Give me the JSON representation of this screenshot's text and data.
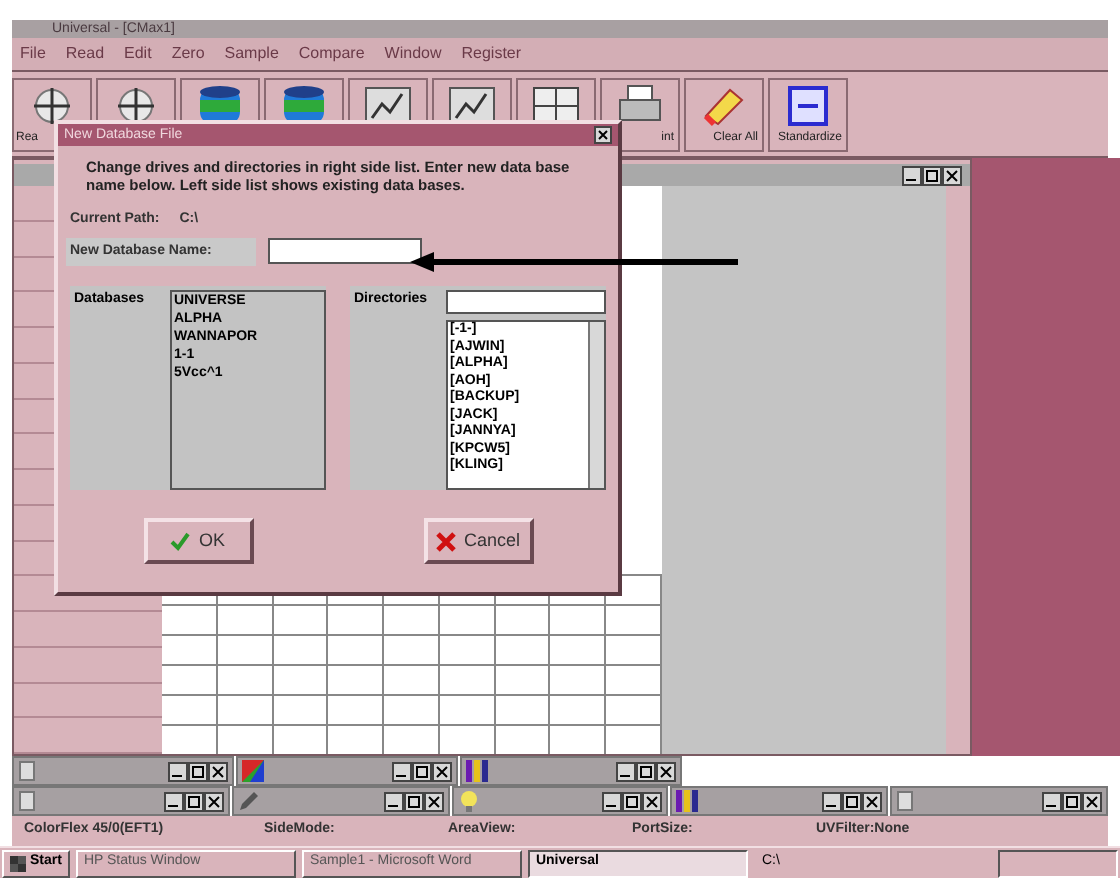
{
  "window": {
    "title": "Universal - [CMax1]"
  },
  "menu": [
    "File",
    "Read",
    "Edit",
    "Zero",
    "Sample",
    "Compare",
    "Window",
    "Register"
  ],
  "toolbar": [
    {
      "kind": "target",
      "label": "Rea"
    },
    {
      "kind": "target"
    },
    {
      "kind": "cylinder"
    },
    {
      "kind": "cylinder"
    },
    {
      "kind": "chart"
    },
    {
      "kind": "chart"
    },
    {
      "kind": "grid"
    },
    {
      "kind": "printer",
      "label": "int"
    },
    {
      "kind": "eraser",
      "label": "Clear All"
    },
    {
      "kind": "standard",
      "label": "Standardize"
    }
  ],
  "dialog": {
    "title": "New Database File",
    "instructions": "Change drives and directories in right side list. Enter new data base name below. Left side list shows existing data bases.",
    "path_label": "Current Path:",
    "path": "C:\\",
    "name_label": "New Database Name:",
    "databases_label": "Databases",
    "databases": [
      "UNIVERSE",
      "ALPHA",
      "WANNAPOR",
      "1-1",
      "5Vcc^1"
    ],
    "directories_label": "Directories",
    "directories": [
      "[-1-]",
      "[AJWIN]",
      "[ALPHA]",
      "[AOH]",
      "[BACKUP]",
      "[JACK]",
      "[JANNYA]",
      "[KPCW5]",
      "[KLING]"
    ],
    "buttons": [
      {
        "kind": "ok",
        "label": "OK"
      },
      {
        "kind": "cancel",
        "label": "Cancel"
      }
    ]
  },
  "minimized": [
    [
      {
        "kind": "doc"
      },
      {
        "kind": "color"
      },
      {
        "kind": "bars"
      }
    ],
    [
      {
        "kind": "doc"
      },
      {
        "kind": "pen"
      },
      {
        "kind": "lamp"
      },
      {
        "kind": "bars"
      },
      {
        "kind": "doc"
      }
    ]
  ],
  "status_bar": [
    "ColorFlex 45/0(EFT1)",
    "SideMode:",
    "AreaView:",
    "PortSize:",
    "UVFilter:None"
  ],
  "taskbar": {
    "start": "Start",
    "tasks": [
      {
        "label": "HP Status Window",
        "selected": false
      },
      {
        "label": "Sample1 - Microsoft Word",
        "selected": false
      },
      {
        "label": "Universal",
        "selected": true
      }
    ],
    "path": "C:\\"
  }
}
